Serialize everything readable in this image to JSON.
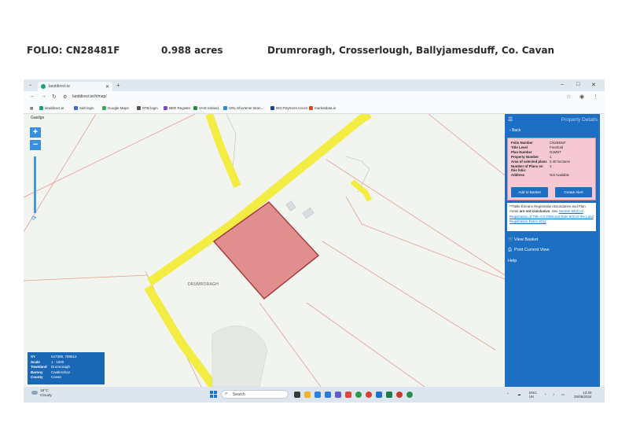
{
  "header": {
    "folio": "FOLIO: CN28481F",
    "acres": "0.988 acres",
    "address": "Drumroragh, Crosserlough, Ballyjamesduff, Co. Cavan"
  },
  "browser": {
    "tab_title": "landdirect.ie",
    "url": "landdirect.ie/#/map/",
    "bookmarks": [
      "landdirect.ie",
      "Salt login",
      "Google Maps",
      "RTB login",
      "BER Register",
      "VAIS Ireland",
      "URL Shortener Bran...",
      "BOI Payment Acces",
      "marketdata.ie"
    ]
  },
  "map": {
    "language_toggle": "Gaeilge",
    "zoom_in": "+",
    "zoom_out": "−",
    "townland_label": "DRUMRORAGH",
    "info_box": [
      {
        "key": "XY",
        "value": "647309, 788512"
      },
      {
        "key": "Scale",
        "value": "1 : 1000"
      },
      {
        "key": "Townland",
        "value": "Drumroragh"
      },
      {
        "key": "Barony",
        "value": "Castlerahan"
      },
      {
        "key": "County",
        "value": "Cavan"
      }
    ]
  },
  "panel": {
    "title": "Property Details",
    "back": "Back",
    "details": [
      {
        "key": "Folio Number",
        "value": "CN28481F"
      },
      {
        "key": "Title Level",
        "value": "Freehold"
      },
      {
        "key": "Plan Number",
        "value": "D1MNT"
      },
      {
        "key": "Property Number",
        "value": "1"
      },
      {
        "key": "Area of selected plans",
        "value": "0.40 hectares"
      },
      {
        "key": "Number of Plans on this folio:",
        "value": "1"
      },
      {
        "key": "Address",
        "value": "Not Available"
      }
    ],
    "add_to_basket": "Add to Basket",
    "create_alert": "Create Alert",
    "note_prefix": "**Tailte Éireann Registration Boundaries and Plan Areas ",
    "note_bold": "are not conclusive",
    "note_mid": ". See ",
    "note_link": "Section 62(2) of Registration of Title Act 2006 and Rule 8(3) of the Land Registration Rules 2012",
    "view_basket": "View Basket",
    "print_view": "Print Current View",
    "help": "Help",
    "colors": {
      "panel": "#1d6fc4",
      "detail_box": "#f5c9d3"
    }
  },
  "taskbar": {
    "weather_temp": "16°C",
    "weather_desc": "Cloudy",
    "search_placeholder": "Search",
    "lang": "ENG",
    "region": "UK",
    "time": "13:29",
    "date": "26/08/2024"
  }
}
